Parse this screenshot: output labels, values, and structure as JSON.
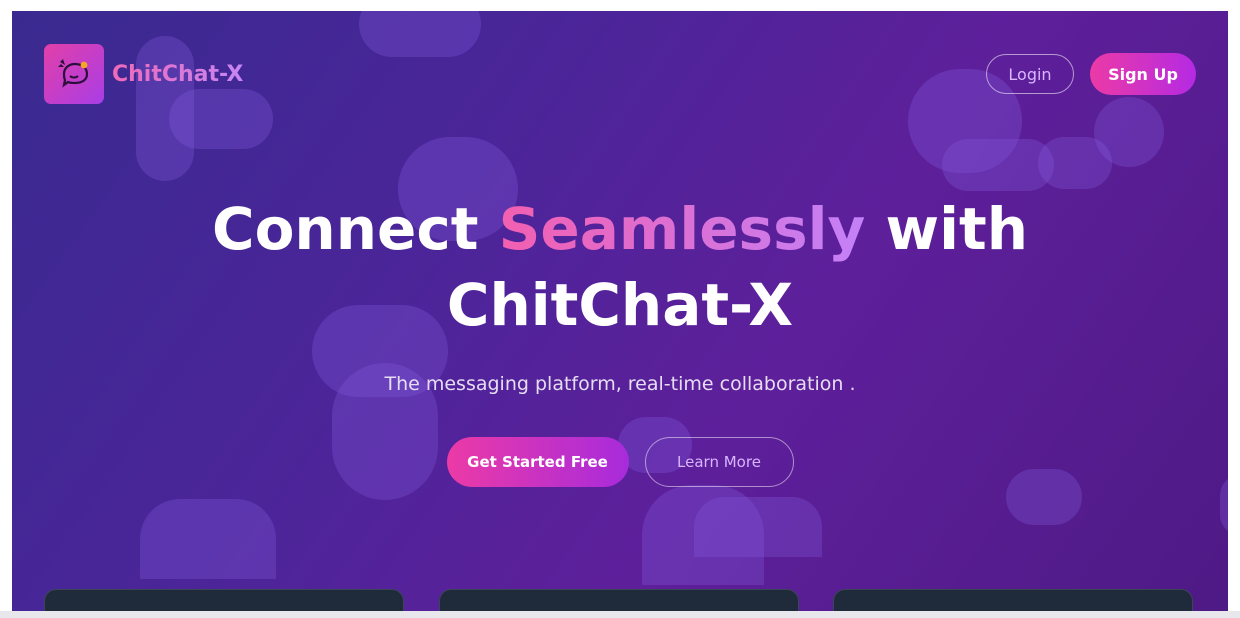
{
  "brand": {
    "name": "ChitChat-X"
  },
  "nav": {
    "login_label": "Login",
    "signup_label": "Sign Up"
  },
  "hero": {
    "headline_part1": "Connect",
    "headline_accent": "Seamlessly",
    "headline_part2": "with",
    "headline_line2": "ChitChat-X",
    "subtitle": "The messaging platform, real-time collaboration ."
  },
  "cta": {
    "primary_label": "Get Started Free",
    "secondary_label": "Learn More"
  },
  "colors": {
    "background_start": "#3a2a90",
    "background_end": "#5e1f9b",
    "accent_pink": "#ec3aa6",
    "accent_purple": "#b42ae3",
    "card": "#1f2a3a"
  },
  "icons": {
    "logo": "chat-bubble-logo-icon"
  }
}
